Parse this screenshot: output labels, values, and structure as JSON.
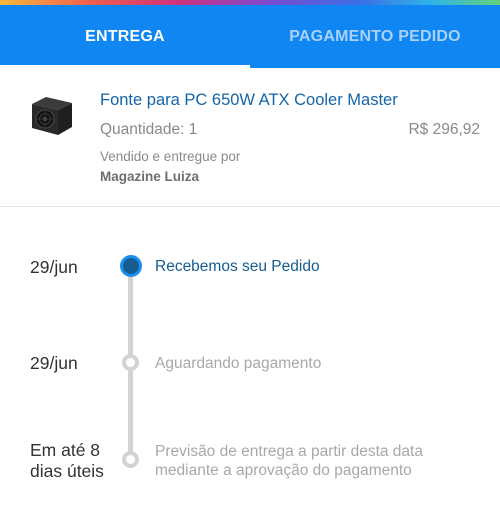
{
  "tabs": [
    {
      "label": "ENTREGA",
      "active": true
    },
    {
      "label": "PAGAMENTO PEDIDO",
      "active": false
    }
  ],
  "product": {
    "name": "Fonte para PC 650W ATX Cooler Master",
    "quantity_text": "Quantidade: 1",
    "price": "R$ 296,92",
    "sold_by_label": "Vendido e entregue por",
    "seller": "Magazine Luiza",
    "image_icon": "power-supply-icon"
  },
  "timeline": [
    {
      "date": "29/jun",
      "label": "Recebemos seu Pedido",
      "status": "done"
    },
    {
      "date": "29/jun",
      "label": "Aguardando pagamento",
      "status": "pending"
    },
    {
      "date": "Em até 8 dias úteis",
      "label": "Previsão de entrega a partir desta data mediante a aprovação do pagamento",
      "status": "pending"
    }
  ],
  "colors": {
    "header_blue": "#0f86f1",
    "link_blue": "#1464a8",
    "active_step": "#155c8f",
    "muted_text": "#8a8a8a",
    "line_gray": "#d3d3d3"
  }
}
